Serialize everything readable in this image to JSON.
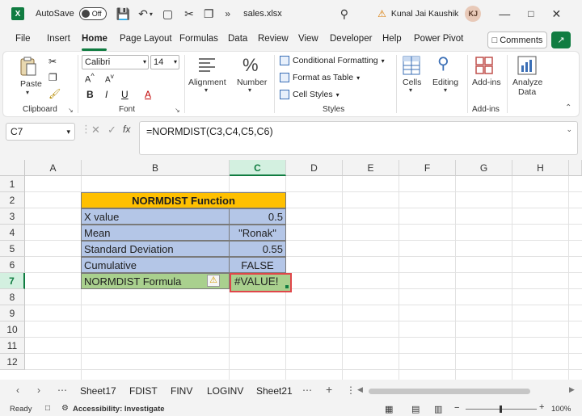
{
  "titlebar": {
    "autosave_label": "AutoSave",
    "autosave_state": "Off",
    "filename": "sales.xlsx",
    "user_name": "Kunal Jai Kaushik",
    "user_initials": "KJ"
  },
  "menu": {
    "items": [
      "File",
      "Insert",
      "Home",
      "Page Layout",
      "Formulas",
      "Data",
      "Review",
      "View",
      "Developer",
      "Help",
      "Power Pivot"
    ],
    "active": "Home",
    "comments_label": "Comments"
  },
  "ribbon": {
    "clipboard": {
      "paste": "Paste",
      "group": "Clipboard"
    },
    "font": {
      "name": "Calibri",
      "size": "14",
      "group": "Font"
    },
    "alignment": "Alignment",
    "number": "Number",
    "styles": {
      "conditional": "Conditional Formatting",
      "format_table": "Format as Table",
      "cell_styles": "Cell Styles",
      "group": "Styles"
    },
    "cells": "Cells",
    "editing": "Editing",
    "addins": {
      "label": "Add-ins",
      "group": "Add-ins"
    },
    "analyze": {
      "line1": "Analyze",
      "line2": "Data"
    }
  },
  "formula_bar": {
    "name_box": "C7",
    "formula": "=NORMDIST(C3,C4,C5,C6)"
  },
  "grid": {
    "columns": [
      "A",
      "B",
      "C",
      "D",
      "E",
      "F",
      "G",
      "H"
    ],
    "rows": [
      "1",
      "2",
      "3",
      "4",
      "5",
      "6",
      "7",
      "8",
      "9",
      "10",
      "11",
      "12"
    ],
    "selected_col": "C",
    "selected_row": "7",
    "title": "NORMDIST Function",
    "labels": [
      "X value",
      "Mean",
      "Standard Deviation",
      "Cumulative",
      "NORMDIST Formula"
    ],
    "values": [
      "0.5",
      "\"Ronak\"",
      "0.55",
      "FALSE",
      "#VALUE!"
    ],
    "colors": {
      "title_fill": "#ffc000",
      "data_fill": "#b4c6e7",
      "formula_fill": "#a9d08e",
      "error_border": "#e0464a",
      "accent": "#107c41"
    }
  },
  "sheets": {
    "tabs": [
      "Sheet17",
      "FDIST",
      "FINV",
      "LOGINV",
      "Sheet21"
    ]
  },
  "status": {
    "ready": "Ready",
    "accessibility": "Accessibility: Investigate",
    "zoom": "100%"
  }
}
